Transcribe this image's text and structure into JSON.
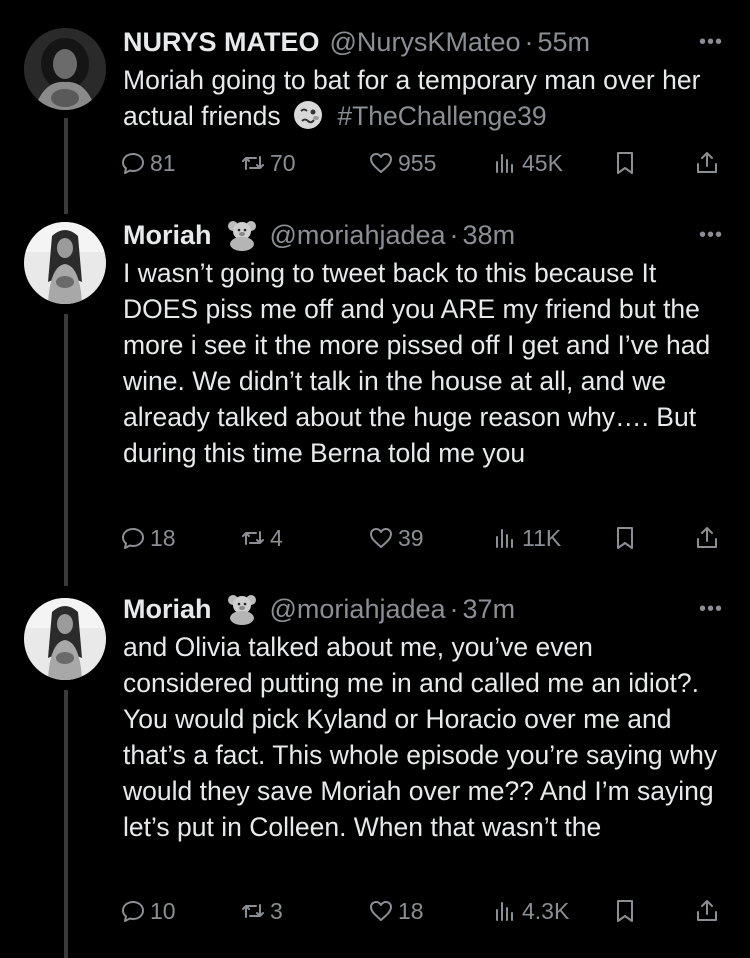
{
  "tweets": [
    {
      "name": "NURYS MATEO",
      "handle": "@NurysKMateo",
      "separator": "·",
      "time": "55m",
      "text": "Moriah going to bat for a temporary man over her actual friends",
      "hashtag": "#TheChallenge39",
      "stats": {
        "replies": "81",
        "retweets": "70",
        "likes": "955",
        "views": "45K"
      }
    },
    {
      "name": "Moriah",
      "handle": "@moriahjadea",
      "separator": "·",
      "time": "38m",
      "text": "I wasn’t going to tweet back to this because It DOES piss me off and you ARE my friend but the more i see it the more pissed off I get and I’ve had wine. We didn’t talk in the house at all, and we already talked about the huge reason why…. But during this time Berna told me you",
      "stats": {
        "replies": "18",
        "retweets": "4",
        "likes": "39",
        "views": "11K"
      }
    },
    {
      "name": "Moriah",
      "handle": "@moriahjadea",
      "separator": "·",
      "time": "37m",
      "text": "and Olivia talked about me, you’ve even considered putting me in and called me an idiot?. You would pick Kyland or Horacio over me and that’s a fact. This whole episode you’re saying why would they save Moriah over me?? And I’m saying let’s put in Colleen. When that wasn’t the",
      "stats": {
        "replies": "10",
        "retweets": "3",
        "likes": "18",
        "views": "4.3K"
      }
    }
  ],
  "icons": {
    "more": "more-icon",
    "reply": "reply-icon",
    "retweet": "retweet-icon",
    "like": "heart-icon",
    "views": "views-icon",
    "bookmark": "bookmark-icon",
    "share": "share-icon"
  },
  "colors": {
    "background": "#000000",
    "text": "#e7e9ea",
    "muted": "#8b8f94",
    "thread_line": "#3a3a3a"
  }
}
